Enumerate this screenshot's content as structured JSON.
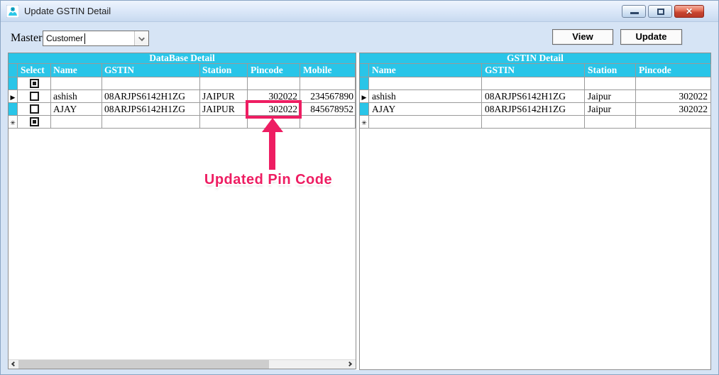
{
  "window": {
    "title": "Update GSTIN Detail",
    "icons": {
      "app": "app-logo-icon",
      "minimize": "minimize-icon",
      "maximize": "maximize-icon",
      "close": "close-icon",
      "close_glyph": "✕"
    }
  },
  "toolbar": {
    "master_label": "Master",
    "master_value": "Customer",
    "view_label": "View",
    "update_label": "Update"
  },
  "left_grid": {
    "title": "DataBase Detail",
    "columns": [
      "Select",
      "Name",
      "GSTIN",
      "Station",
      "Pincode",
      "Mobile"
    ],
    "rows": [
      {
        "indicator": "",
        "header": "cyan",
        "checkbox": "filled",
        "name": "",
        "gstin": "",
        "station": "",
        "pincode": "",
        "mobile": ""
      },
      {
        "indicator": "▶",
        "header": "light",
        "checkbox": "empty",
        "name": "ashish",
        "gstin": "08ARJPS6142H1ZG",
        "station": "JAIPUR",
        "pincode": "302022",
        "mobile": "234567890"
      },
      {
        "indicator": "",
        "header": "cyan",
        "checkbox": "empty",
        "name": "AJAY",
        "gstin": "08ARJPS6142H1ZG",
        "station": "JAIPUR",
        "pincode": "302022",
        "mobile": "845678952"
      },
      {
        "indicator": "✳",
        "header": "light",
        "checkbox": "filled",
        "name": "",
        "gstin": "",
        "station": "",
        "pincode": "",
        "mobile": ""
      }
    ]
  },
  "right_grid": {
    "title": "GSTIN Detail",
    "columns": [
      "Name",
      "GSTIN",
      "Station",
      "Pincode"
    ],
    "rows": [
      {
        "indicator": "",
        "header": "cyan",
        "name": "",
        "gstin": "",
        "station": "",
        "pincode": ""
      },
      {
        "indicator": "▶",
        "header": "light",
        "name": "ashish",
        "gstin": "08ARJPS6142H1ZG",
        "station": "Jaipur",
        "pincode": "302022"
      },
      {
        "indicator": "",
        "header": "cyan",
        "name": "AJAY",
        "gstin": "08ARJPS6142H1ZG",
        "station": "Jaipur",
        "pincode": "302022"
      },
      {
        "indicator": "✳",
        "header": "light",
        "name": "",
        "gstin": "",
        "station": "",
        "pincode": ""
      }
    ]
  },
  "annotation": {
    "label": "Updated Pin Code"
  },
  "colors": {
    "header_cyan": "#29c5e8",
    "annotation_pink": "#ee1d62",
    "close_red": "#c64430"
  }
}
